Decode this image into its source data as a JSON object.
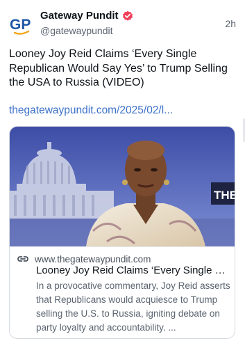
{
  "post": {
    "author": {
      "display_name": "Gateway Pundit",
      "handle": "@gatewaypundit",
      "avatar_text": "GP",
      "verified": true
    },
    "timestamp": "2h",
    "text": "Looney Joy Reid Claims ‘Every Single Republican Would Say Yes’ to Trump Selling the USA to Russia (VIDEO)",
    "link_text": "thegatewaypundit.com/2025/02/l..."
  },
  "card": {
    "image_icon": "capitol-dome-news-anchor-photo",
    "image_overlay_text": "THE RE",
    "domain": "www.thegatewaypundit.com",
    "title": "Looney Joy Reid Claims ‘Every Single Republican Would Say Yes’ to Trump Selling the USA to Russia (VIDEO)",
    "description": "In a provocative commentary, Joy Reid asserts that Republicans would acquiesce to Trump selling the U.S. to Russia, igniting debate on party loyalty and accountability. ..."
  },
  "colors": {
    "link": "#3d72c8",
    "verified_badge": "#ef3f5a",
    "avatar_blue": "#1f56a5",
    "avatar_orange": "#f2a516"
  }
}
